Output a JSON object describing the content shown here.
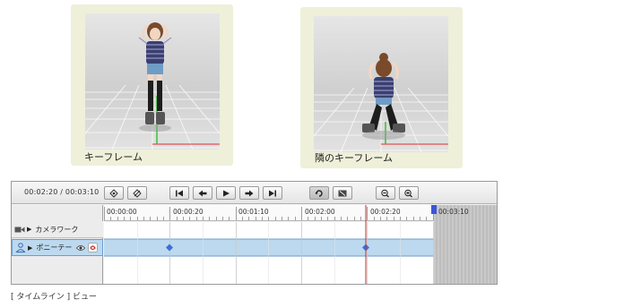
{
  "callouts": {
    "left": {
      "caption": "キーフレーム",
      "pose": "standing"
    },
    "right": {
      "caption": "隣のキーフレーム",
      "pose": "crouching"
    }
  },
  "timeline": {
    "time_readout": "00:02:20 / 00:03:10",
    "ticks": [
      "00:00:00",
      "00:00:20",
      "00:01:10",
      "00:02:00",
      "00:02:20"
    ],
    "out_of_range_label": "00:03:10",
    "tracks": [
      {
        "label": "カメラワーク",
        "icon": "camera-icon"
      },
      {
        "label": "ポニーテー",
        "icon": "person-icon",
        "selected": true
      }
    ],
    "toolbar_icons": [
      "add-keyframe-icon",
      "delete-keyframe-icon",
      "go-to-start-icon",
      "previous-keyframe-icon",
      "play-icon",
      "next-keyframe-icon",
      "go-to-end-icon",
      "loop-icon",
      "range-icon",
      "zoom-out-icon",
      "zoom-in-icon"
    ],
    "colors": {
      "keyframe": "#3d6fdc",
      "playhead": "#c83232",
      "selected_track": "#bcd9ef",
      "end_marker": "#3c55d8"
    }
  },
  "page_caption": "[ タイムライン ] ビュー"
}
